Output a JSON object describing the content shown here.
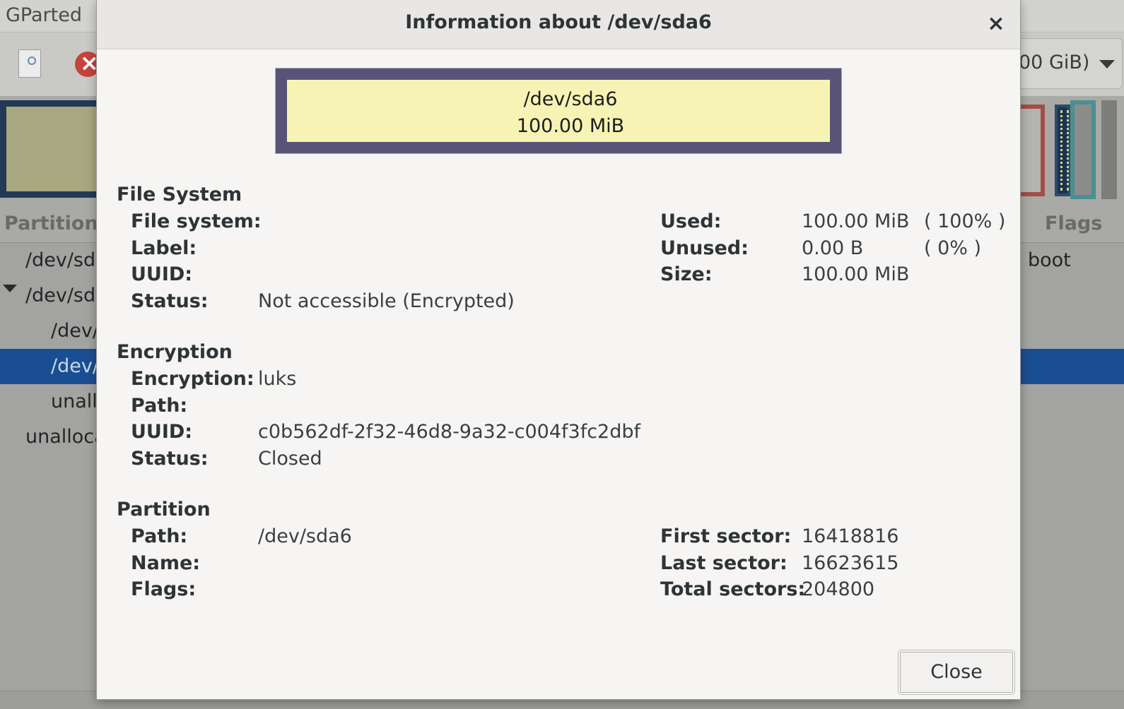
{
  "app": {
    "title": "GParted",
    "device_selector": "00 GiB)"
  },
  "partition_list": {
    "columns": {
      "partition": "Partition",
      "flags": "Flags"
    },
    "rows": [
      {
        "name": "/dev/sda",
        "flags": "boot"
      },
      {
        "name": "/dev/sda"
      },
      {
        "name": "/dev/"
      },
      {
        "name": "/dev/"
      },
      {
        "name": "unall"
      },
      {
        "name": "unalloca"
      }
    ]
  },
  "dialog": {
    "title": "Information about /dev/sda6",
    "graphic": {
      "name": "/dev/sda6",
      "size": "100.00 MiB"
    },
    "file_system": {
      "heading": "File System",
      "fields": [
        {
          "label": "File system:",
          "value": ""
        },
        {
          "label": "Label:",
          "value": ""
        },
        {
          "label": "UUID:",
          "value": ""
        },
        {
          "label": "Status:",
          "value": "Not accessible (Encrypted)"
        }
      ],
      "usage": [
        {
          "label": "Used:",
          "value": "100.00 MiB",
          "percent": "( 100% )"
        },
        {
          "label": "Unused:",
          "value": "0.00 B",
          "percent": "( 0% )"
        },
        {
          "label": "Size:",
          "value": "100.00 MiB",
          "percent": ""
        }
      ]
    },
    "encryption": {
      "heading": "Encryption",
      "fields": [
        {
          "label": "Encryption:",
          "value": "luks"
        },
        {
          "label": "Path:",
          "value": ""
        },
        {
          "label": "UUID:",
          "value": "c0b562df-2f32-46d8-9a32-c004f3fc2dbf"
        },
        {
          "label": "Status:",
          "value": "Closed"
        }
      ]
    },
    "partition": {
      "heading": "Partition",
      "fields": [
        {
          "label": "Path:",
          "value": "/dev/sda6"
        },
        {
          "label": "Name:",
          "value": ""
        },
        {
          "label": "Flags:",
          "value": ""
        }
      ],
      "sectors": [
        {
          "label": "First sector:",
          "value": "16418816"
        },
        {
          "label": "Last sector:",
          "value": "16623615"
        },
        {
          "label": "Total sectors:",
          "value": "204800"
        }
      ]
    },
    "close_label": "Close"
  },
  "colors": {
    "selection": "#1a4e92",
    "partition_border": "#5a5378",
    "partition_fill": "#f7f3b4"
  }
}
